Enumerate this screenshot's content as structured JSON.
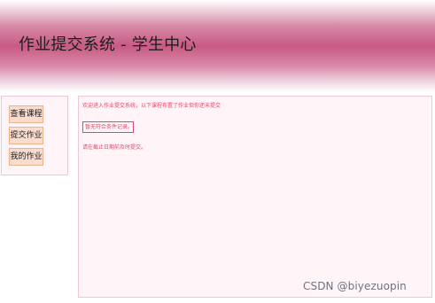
{
  "header": {
    "title": "作业提交系统 - 学生中心"
  },
  "sidebar": {
    "items": [
      {
        "label": "查看课程"
      },
      {
        "label": "提交作业"
      },
      {
        "label": "我的作业"
      }
    ]
  },
  "main": {
    "welcome_text": "欢迎进入作业提交系统，以下课程布置了作业但你还未提交",
    "empty_message": "暂无符合条件记录。",
    "deadline_notice": "请在截止日期前及时提交。"
  },
  "watermark": {
    "text": "CSDN @biyezuopin"
  }
}
